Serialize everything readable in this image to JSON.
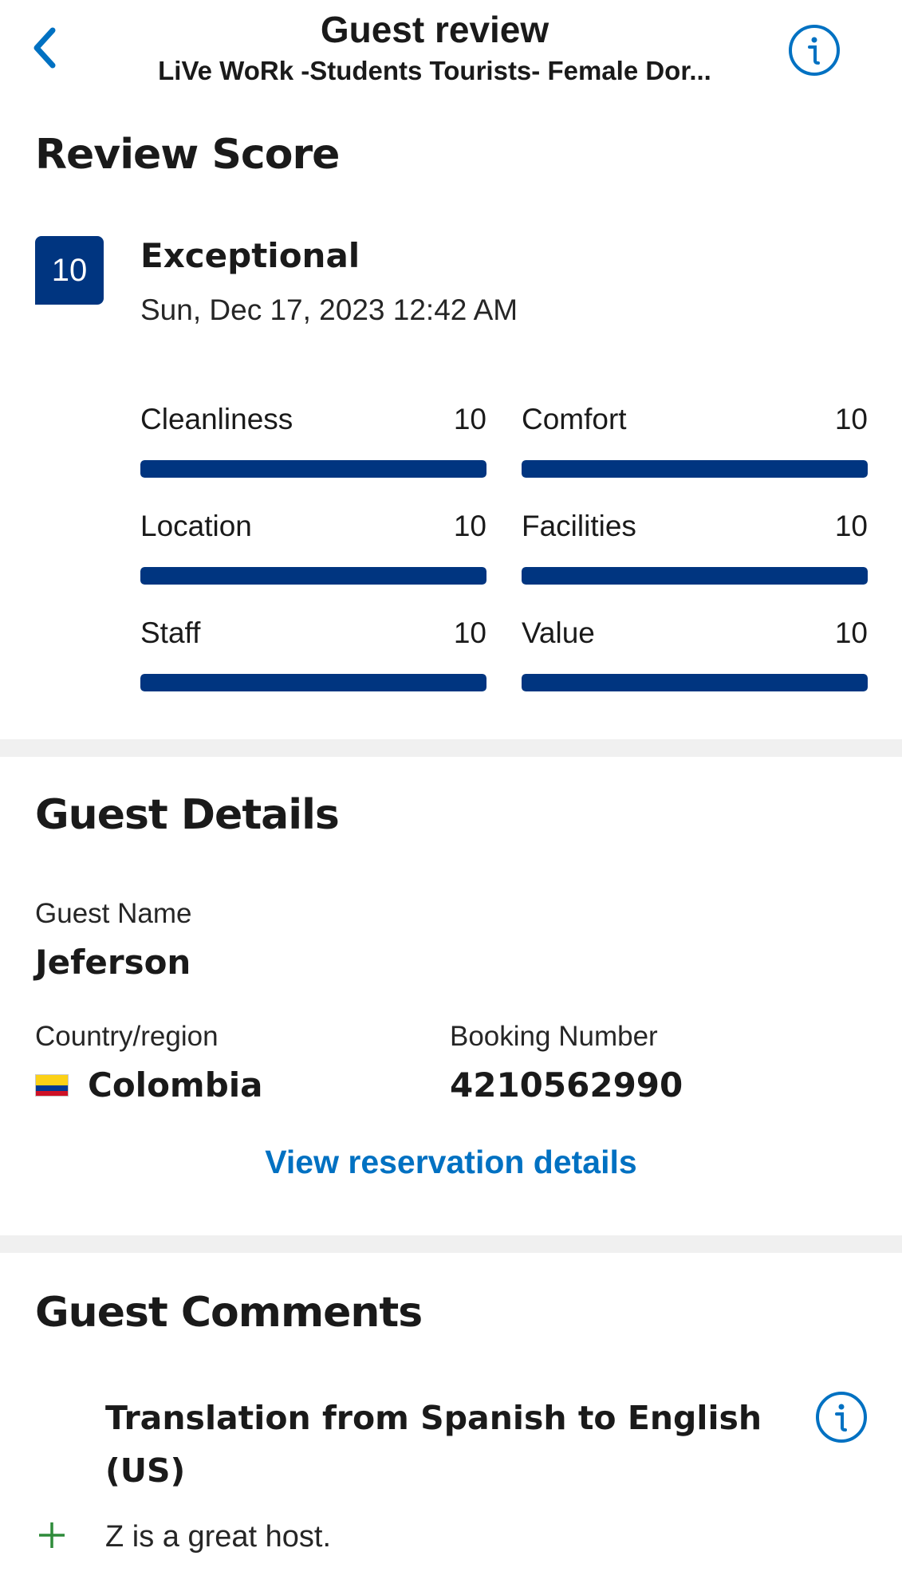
{
  "header": {
    "title": "Guest review",
    "subtitle": "LiVe WoRk -Students Tourists- Female Dor..."
  },
  "review_score": {
    "heading": "Review Score",
    "score": "10",
    "rating_label": "Exceptional",
    "date": "Sun, Dec 17, 2023 12:42 AM",
    "categories": [
      {
        "name": "Cleanliness",
        "score": "10",
        "fill": 1.0
      },
      {
        "name": "Comfort",
        "score": "10",
        "fill": 1.0
      },
      {
        "name": "Location",
        "score": "10",
        "fill": 1.0
      },
      {
        "name": "Facilities",
        "score": "10",
        "fill": 1.0
      },
      {
        "name": "Staff",
        "score": "10",
        "fill": 1.0
      },
      {
        "name": "Value",
        "score": "10",
        "fill": 1.0
      }
    ],
    "bar_color": "#003580"
  },
  "guest_details": {
    "heading": "Guest Details",
    "name_label": "Guest Name",
    "name": "Jeferson",
    "country_label": "Country/region",
    "country": "Colombia",
    "booking_label": "Booking Number",
    "booking_number": "4210562990",
    "link": "View reservation details"
  },
  "guest_comments": {
    "heading": "Guest Comments",
    "translation_note": "Translation from Spanish to English (US)",
    "comments": [
      {
        "icon": "plus-icon",
        "text": "Z is a great host."
      }
    ]
  },
  "colors": {
    "accent": "#0071c2",
    "brand": "#003580",
    "positive": "#2e8b3a"
  }
}
